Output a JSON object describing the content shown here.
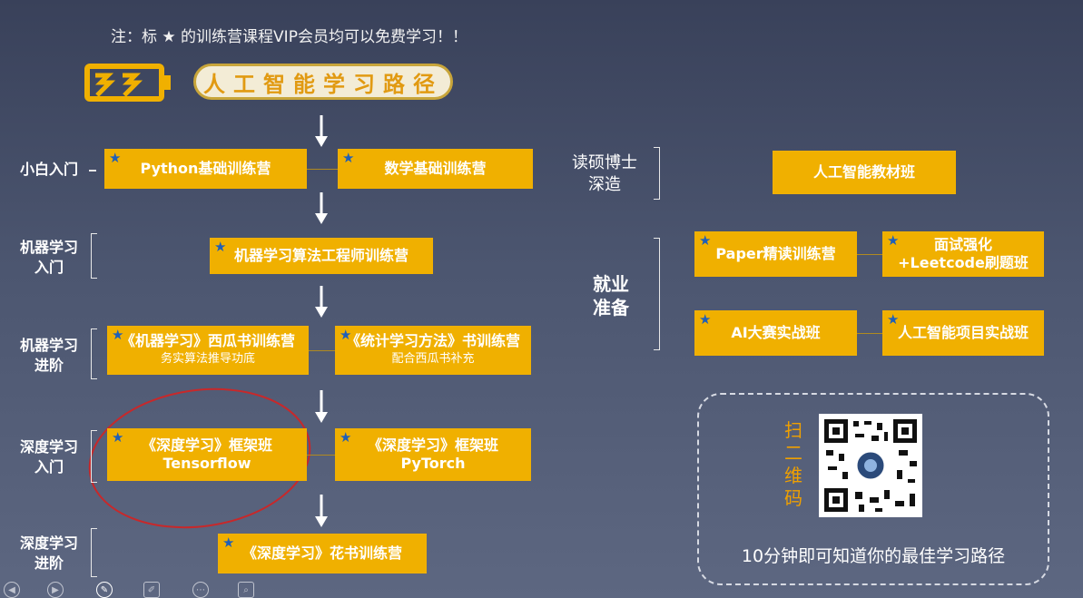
{
  "note": "注：标 ★ 的训练营课程VIP会员均可以免费学习！！",
  "title": "人工智能学习路径",
  "stages": {
    "s1": "小白入门",
    "s2a": "机器学习",
    "s2b": "入门",
    "s3a": "机器学习",
    "s3b": "进阶",
    "s4a": "深度学习",
    "s4b": "入门",
    "s5a": "深度学习",
    "s5b": "进阶",
    "r1a": "读硕博士",
    "r1b": "深造",
    "r2a": "就业",
    "r2b": "准备"
  },
  "courses": {
    "python": "Python基础训练营",
    "math": "数学基础训练营",
    "ml_engineer": "机器学习算法工程师训练营",
    "watermelon": "《机器学习》西瓜书训练营",
    "watermelon_sub": "务实算法推导功底",
    "stat": "《统计学习方法》书训练营",
    "stat_sub": "配合西瓜书补充",
    "dl_tf": "《深度学习》框架班",
    "dl_tf_sub": "Tensorflow",
    "dl_pt": "《深度学习》框架班",
    "dl_pt_sub": "PyTorch",
    "flower": "《深度学习》花书训练营",
    "textbook": "人工智能教材班",
    "paper": "Paper精读训练营",
    "interview_a": "面试强化",
    "interview_b": "+Leetcode刷题班",
    "ai_contest": "AI大赛实战班",
    "ai_project": "人工智能项目实战班"
  },
  "qr": {
    "label": [
      "扫",
      "二",
      "维",
      "码"
    ],
    "caption": "10分钟即可知道你的最佳学习路径"
  },
  "colors": {
    "box": "#f0b000",
    "star": "#1f5fb8",
    "circle": "#c8282a",
    "qr_label": "#f0a000"
  }
}
